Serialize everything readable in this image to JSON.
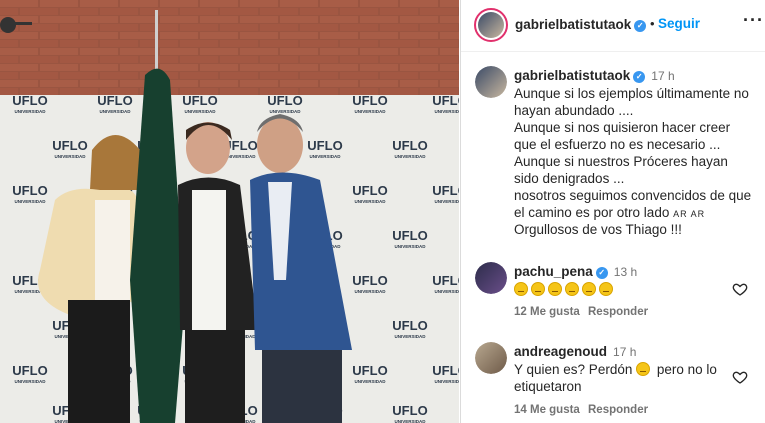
{
  "header": {
    "username": "gabrielbatistutaok",
    "follow_label": "Seguir",
    "more_icon": "more-horizontal-icon",
    "dot": "•"
  },
  "photo": {
    "logo_text": "UFLO",
    "logo_sub": "UNIVERSIDAD"
  },
  "caption": {
    "username": "gabrielbatistutaok",
    "time": "17 h",
    "lines": [
      "Aunque si los ejemplos últimamente no",
      "hayan abundado ....",
      "Aunque si nos quisieron hacer creer",
      "que el esfuerzo no es necesario ...",
      "Aunque si nuestros Próceres hayan",
      "sido denigrados ...",
      "nosotros seguimos convencidos de que",
      "el camino es por otro lado",
      "Orgullosos de vos Thiago !!!"
    ],
    "flag_text": "AR AR"
  },
  "comments": [
    {
      "username": "pachu_pena",
      "verified": true,
      "time": "13 h",
      "text": "",
      "emoji_count": 6,
      "likes": "12 Me gusta",
      "reply": "Responder"
    },
    {
      "username": "andreagenoud",
      "verified": false,
      "time": "17 h",
      "text_line1": "Y quien es? Perdón",
      "text_line1b": "pero no lo",
      "text_line2": "etiquetaron",
      "likes": "14 Me gusta",
      "reply": "Responder"
    }
  ],
  "colors": {
    "accent": "#0095f6",
    "verified": "#3897f0",
    "muted": "#737373",
    "text": "#262626"
  }
}
